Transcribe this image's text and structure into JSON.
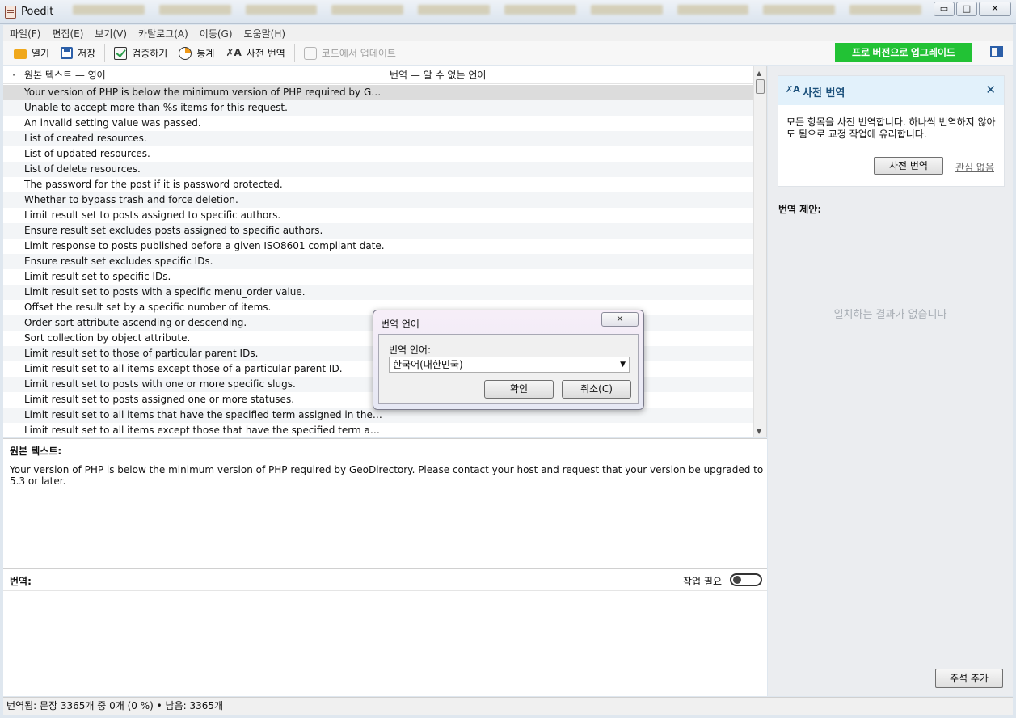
{
  "window": {
    "title": "Poedit",
    "controls": {
      "minimize": "▭",
      "maximize": "□",
      "close": "✕"
    }
  },
  "menu": [
    "파일(F)",
    "편집(E)",
    "보기(V)",
    "카탈로그(A)",
    "이동(G)",
    "도움말(H)"
  ],
  "toolbar": {
    "open": "열기",
    "save": "저장",
    "validate": "검증하기",
    "stats": "통계",
    "pretranslate": "사전 번역",
    "update_from_code": "코드에서 업데이트",
    "upgrade": "프로 버전으로 업그레이드"
  },
  "list": {
    "dot_header": "·",
    "source_header": "원본 텍스트 — 영어",
    "translation_header": "번역 — 알 수 없는 언어",
    "rows": [
      "Your version of PHP is below the minimum version of PHP required by GeoDirec...",
      "Unable to accept more than %s items for this request.",
      "An invalid setting value was passed.",
      "List of created resources.",
      "List of updated resources.",
      "List of delete resources.",
      "The password for the post if it is password protected.",
      "Whether to bypass trash and force deletion.",
      "Limit result set to posts assigned to specific authors.",
      "Ensure result set excludes posts assigned to specific authors.",
      "Limit response to posts published before a given ISO8601 compliant date.",
      "Ensure result set excludes specific IDs.",
      "Limit result set to specific IDs.",
      "Limit result set to posts with a specific menu_order value.",
      "Offset the result set by a specific number of items.",
      "Order sort attribute ascending or descending.",
      "Sort collection by object attribute.",
      "Limit result set to those of particular parent IDs.",
      "Limit result set to all items except those of a particular parent ID.",
      "Limit result set to posts with one or more specific slugs.",
      "Limit result set to posts assigned one or more statuses.",
      "Limit result set to all items that have the specified term assigned in the %s taxon...",
      "Limit result set to all items except those that have the specified term assigned in..."
    ]
  },
  "source": {
    "label": "원본 텍스트:",
    "text": "Your version of PHP is below the minimum version of PHP required by GeoDirectory. Please contact your host and request that your version be upgraded to 5.3 or later."
  },
  "translation": {
    "label": "번역:",
    "needs_work": "작업 필요"
  },
  "sidebar": {
    "pretranslate_title": "사전 번역",
    "pretranslate_desc": "모든 항목을 사전 번역합니다. 하나씩 번역하지 않아도 됨으로 교정 작업에 유리합니다.",
    "pretranslate_button": "사전 번역",
    "dismiss_link": "관심 없음",
    "suggestions_label": "번역 제안:",
    "no_match": "일치하는 결과가 없습니다",
    "add_comment": "주석 추가"
  },
  "status": "번역됨: 문장 3365개 중 0개 (0 %)  •  남음: 3365개",
  "dialog": {
    "title": "번역 언어",
    "field_label": "번역 언어:",
    "selected_language": "한국어(대한민국)",
    "ok": "확인",
    "cancel": "취소(C)"
  }
}
